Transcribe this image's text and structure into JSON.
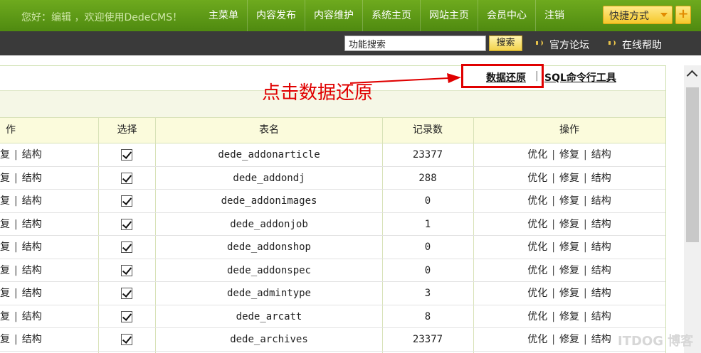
{
  "topbar": {
    "welcome": "您好：编辑 ，欢迎使用DedeCMS！",
    "nav": [
      "主菜单",
      "内容发布",
      "内容维护",
      "系统主页",
      "网站主页",
      "会员中心",
      "注销"
    ],
    "quick_label": "快捷方式",
    "quick_plus": "+"
  },
  "subbar": {
    "search_value": "功能搜索",
    "search_button": "搜索",
    "forum_link": "官方论坛",
    "help_link": "在线帮助"
  },
  "toolbar": {
    "restore_link": "数据还原",
    "separator": "|",
    "sql_link": "SQL命令行工具",
    "annotation": "点击数据还原"
  },
  "table": {
    "headers": [
      "作",
      "选择",
      "表名",
      "记录数",
      "操作"
    ],
    "ops": [
      "优化",
      "修复",
      "结构"
    ],
    "left_ops": [
      "复",
      "结构"
    ],
    "rows": [
      {
        "name": "dede_addonarticle",
        "count": "23377"
      },
      {
        "name": "dede_addondj",
        "count": "288"
      },
      {
        "name": "dede_addonimages",
        "count": "0"
      },
      {
        "name": "dede_addonjob",
        "count": "1"
      },
      {
        "name": "dede_addonshop",
        "count": "0"
      },
      {
        "name": "dede_addonspec",
        "count": "0"
      },
      {
        "name": "dede_admintype",
        "count": "3"
      },
      {
        "name": "dede_arcatt",
        "count": "8"
      },
      {
        "name": "dede_archives",
        "count": "23377"
      }
    ]
  },
  "watermark": "ITDOG 博客"
}
